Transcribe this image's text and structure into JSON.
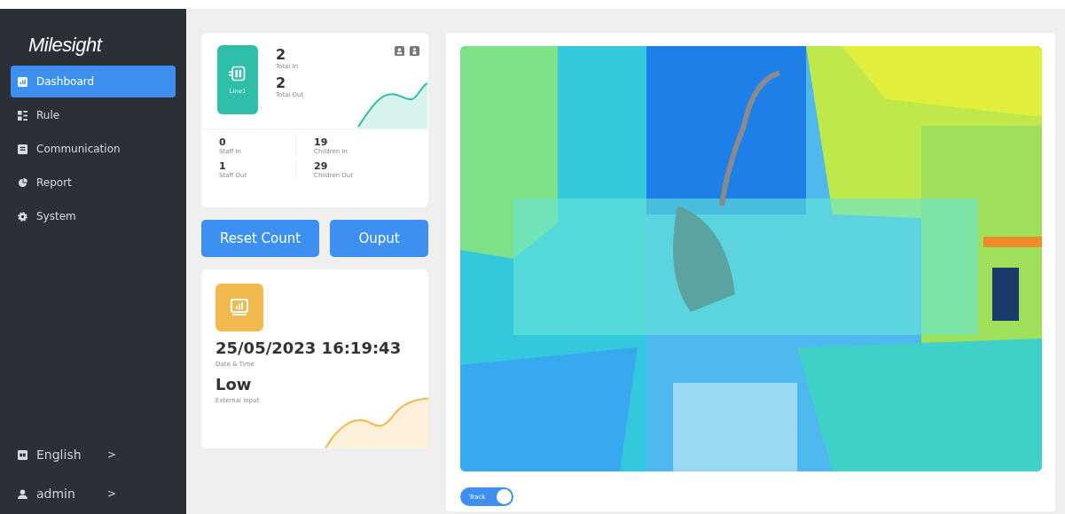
{
  "sidebar": {
    "logo": "Milesight",
    "items": [
      {
        "label": "Dashboard",
        "kind": "chart",
        "selected": true
      },
      {
        "label": "Rule",
        "kind": "list",
        "selected": false
      },
      {
        "label": "Communication",
        "kind": "window",
        "selected": false
      },
      {
        "label": "Report",
        "kind": "pie",
        "selected": false
      },
      {
        "label": "System",
        "kind": "gear",
        "selected": false
      }
    ],
    "footer": [
      {
        "label": "English",
        "kind": "lang",
        "chevron": ">"
      },
      {
        "label": "admin",
        "kind": "user",
        "chevron": ">"
      }
    ]
  },
  "line_card": {
    "badge": "Line1",
    "totals": [
      {
        "value": "2",
        "label": "Total In"
      },
      {
        "value": "2",
        "label": "Total Out"
      }
    ],
    "stats": [
      {
        "value": "0",
        "label": "Staff In"
      },
      {
        "value": "19",
        "label": "Children In"
      },
      {
        "value": "1",
        "label": "Staff Out"
      },
      {
        "value": "29",
        "label": "Children Out"
      }
    ]
  },
  "buttons": [
    "Reset Count",
    "Ouput"
  ],
  "info_card": {
    "datetime": "25/05/2023 16:19:43",
    "datetime_label": "Date & Time",
    "input_value": "Low",
    "input_label": "External Input"
  },
  "camera": {
    "kind": "picture",
    "toggle": {
      "label": "Track",
      "on": true
    }
  }
}
